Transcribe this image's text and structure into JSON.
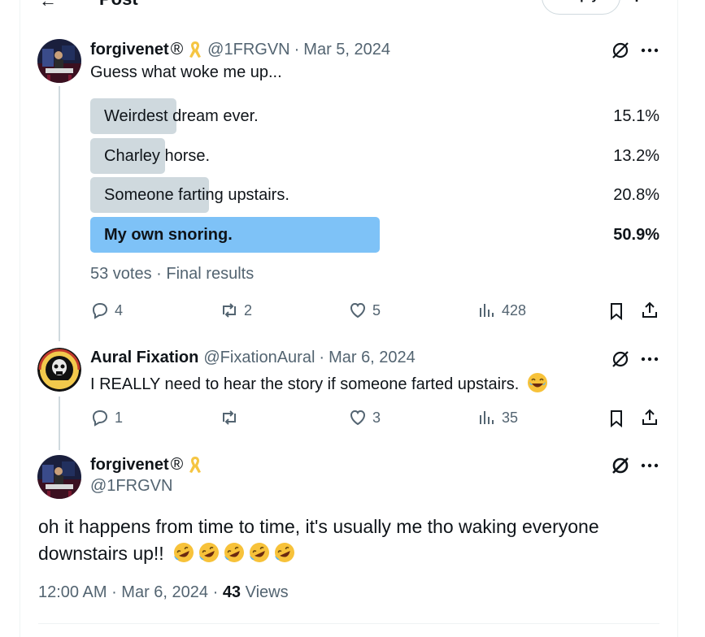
{
  "header": {
    "title": "Post",
    "reply_label": "Reply"
  },
  "posts": [
    {
      "name": "forgivenet",
      "registered": "®",
      "handle": "@1FRGVN",
      "date": "Mar 5, 2024",
      "text": "Guess what woke me up...",
      "poll": {
        "options": [
          {
            "label": "Weirdest dream ever.",
            "pct_label": "15.1%",
            "pct": 15.1,
            "winner": false
          },
          {
            "label": "Charley horse.",
            "pct_label": "13.2%",
            "pct": 13.2,
            "winner": false
          },
          {
            "label": "Someone farting upstairs.",
            "pct_label": "20.8%",
            "pct": 20.8,
            "winner": false
          },
          {
            "label": "My own snoring.",
            "pct_label": "50.9%",
            "pct": 50.9,
            "winner": true
          }
        ],
        "votes": "53 votes",
        "status": "Final results"
      },
      "actions": {
        "replies": "4",
        "reposts": "2",
        "likes": "5",
        "views": "428"
      }
    },
    {
      "name": "Aural Fixation",
      "handle": "@FixationAural",
      "date": "Mar 6, 2024",
      "text": "I REALLY need to hear the story if someone farted upstairs.",
      "actions": {
        "replies": "1",
        "reposts": "",
        "likes": "3",
        "views": "35"
      }
    },
    {
      "name": "forgivenet",
      "registered": "®",
      "handle": "@1FRGVN",
      "text": "oh it happens from time to time, it's usually me tho waking everyone downstairs up!!",
      "time": "12:00 AM",
      "date": "Mar 6, 2024",
      "views_count": "43",
      "views_label": "Views"
    }
  ],
  "colors": {
    "accent": "#1d9bf0",
    "poll_winner": "#7ec2f7",
    "poll_bar": "#cfd9de",
    "secondary_text": "#536471",
    "ribbon": "#f5c542"
  }
}
